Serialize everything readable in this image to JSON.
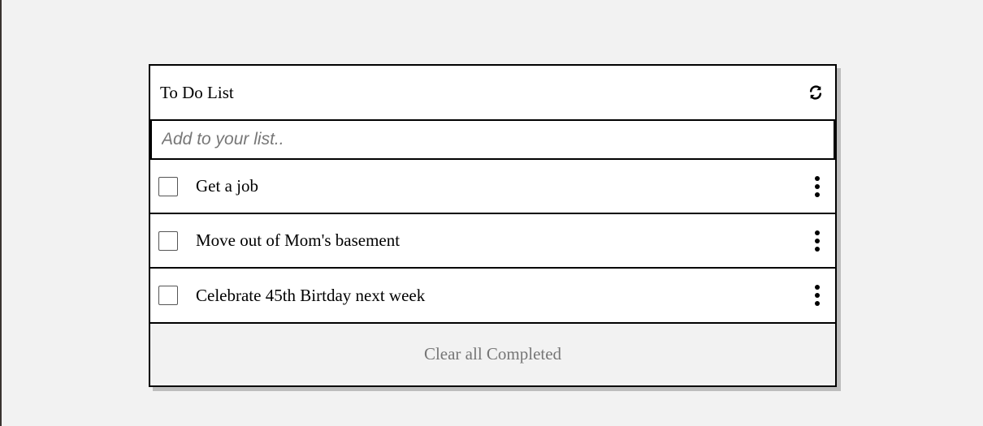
{
  "header": {
    "title": "To Do List",
    "refresh_icon": "refresh-icon"
  },
  "add": {
    "placeholder": "Add to your list..",
    "value": ""
  },
  "items": [
    {
      "text": "Get a job",
      "checked": false
    },
    {
      "text": "Move out of Mom's basement",
      "checked": false
    },
    {
      "text": "Celebrate 45th Birtday next week",
      "checked": false
    }
  ],
  "footer": {
    "clear_label": "Clear all Completed"
  },
  "colors": {
    "background": "#f2f2f2",
    "card": "#ffffff",
    "border": "#000000",
    "shadow": "#bdbdbd",
    "muted_text": "#767676"
  }
}
